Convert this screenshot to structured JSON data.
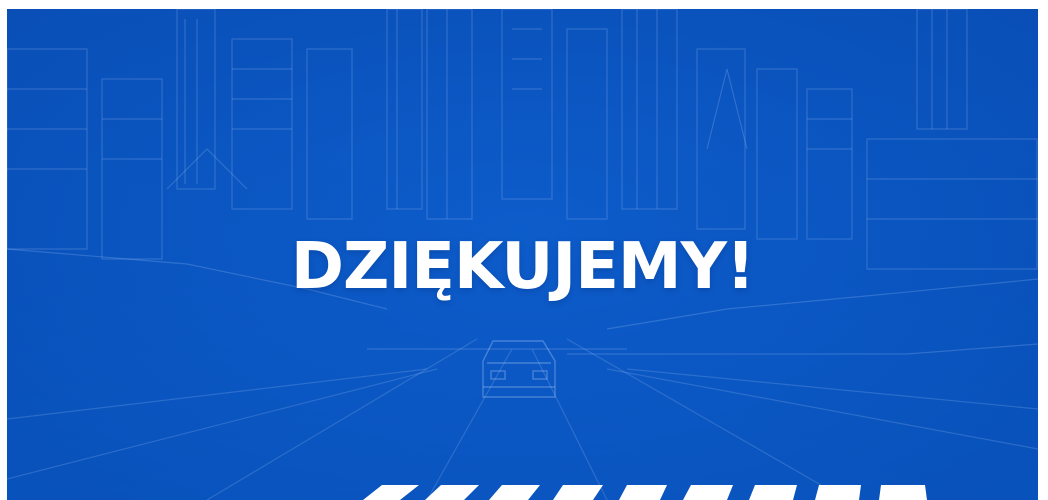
{
  "title": "DZIĘKUJEMY!",
  "colors": {
    "background": "#0a57c4",
    "line_art": "#8fb8f0",
    "text": "#ffffff",
    "crosswalk": "#ffffff"
  }
}
